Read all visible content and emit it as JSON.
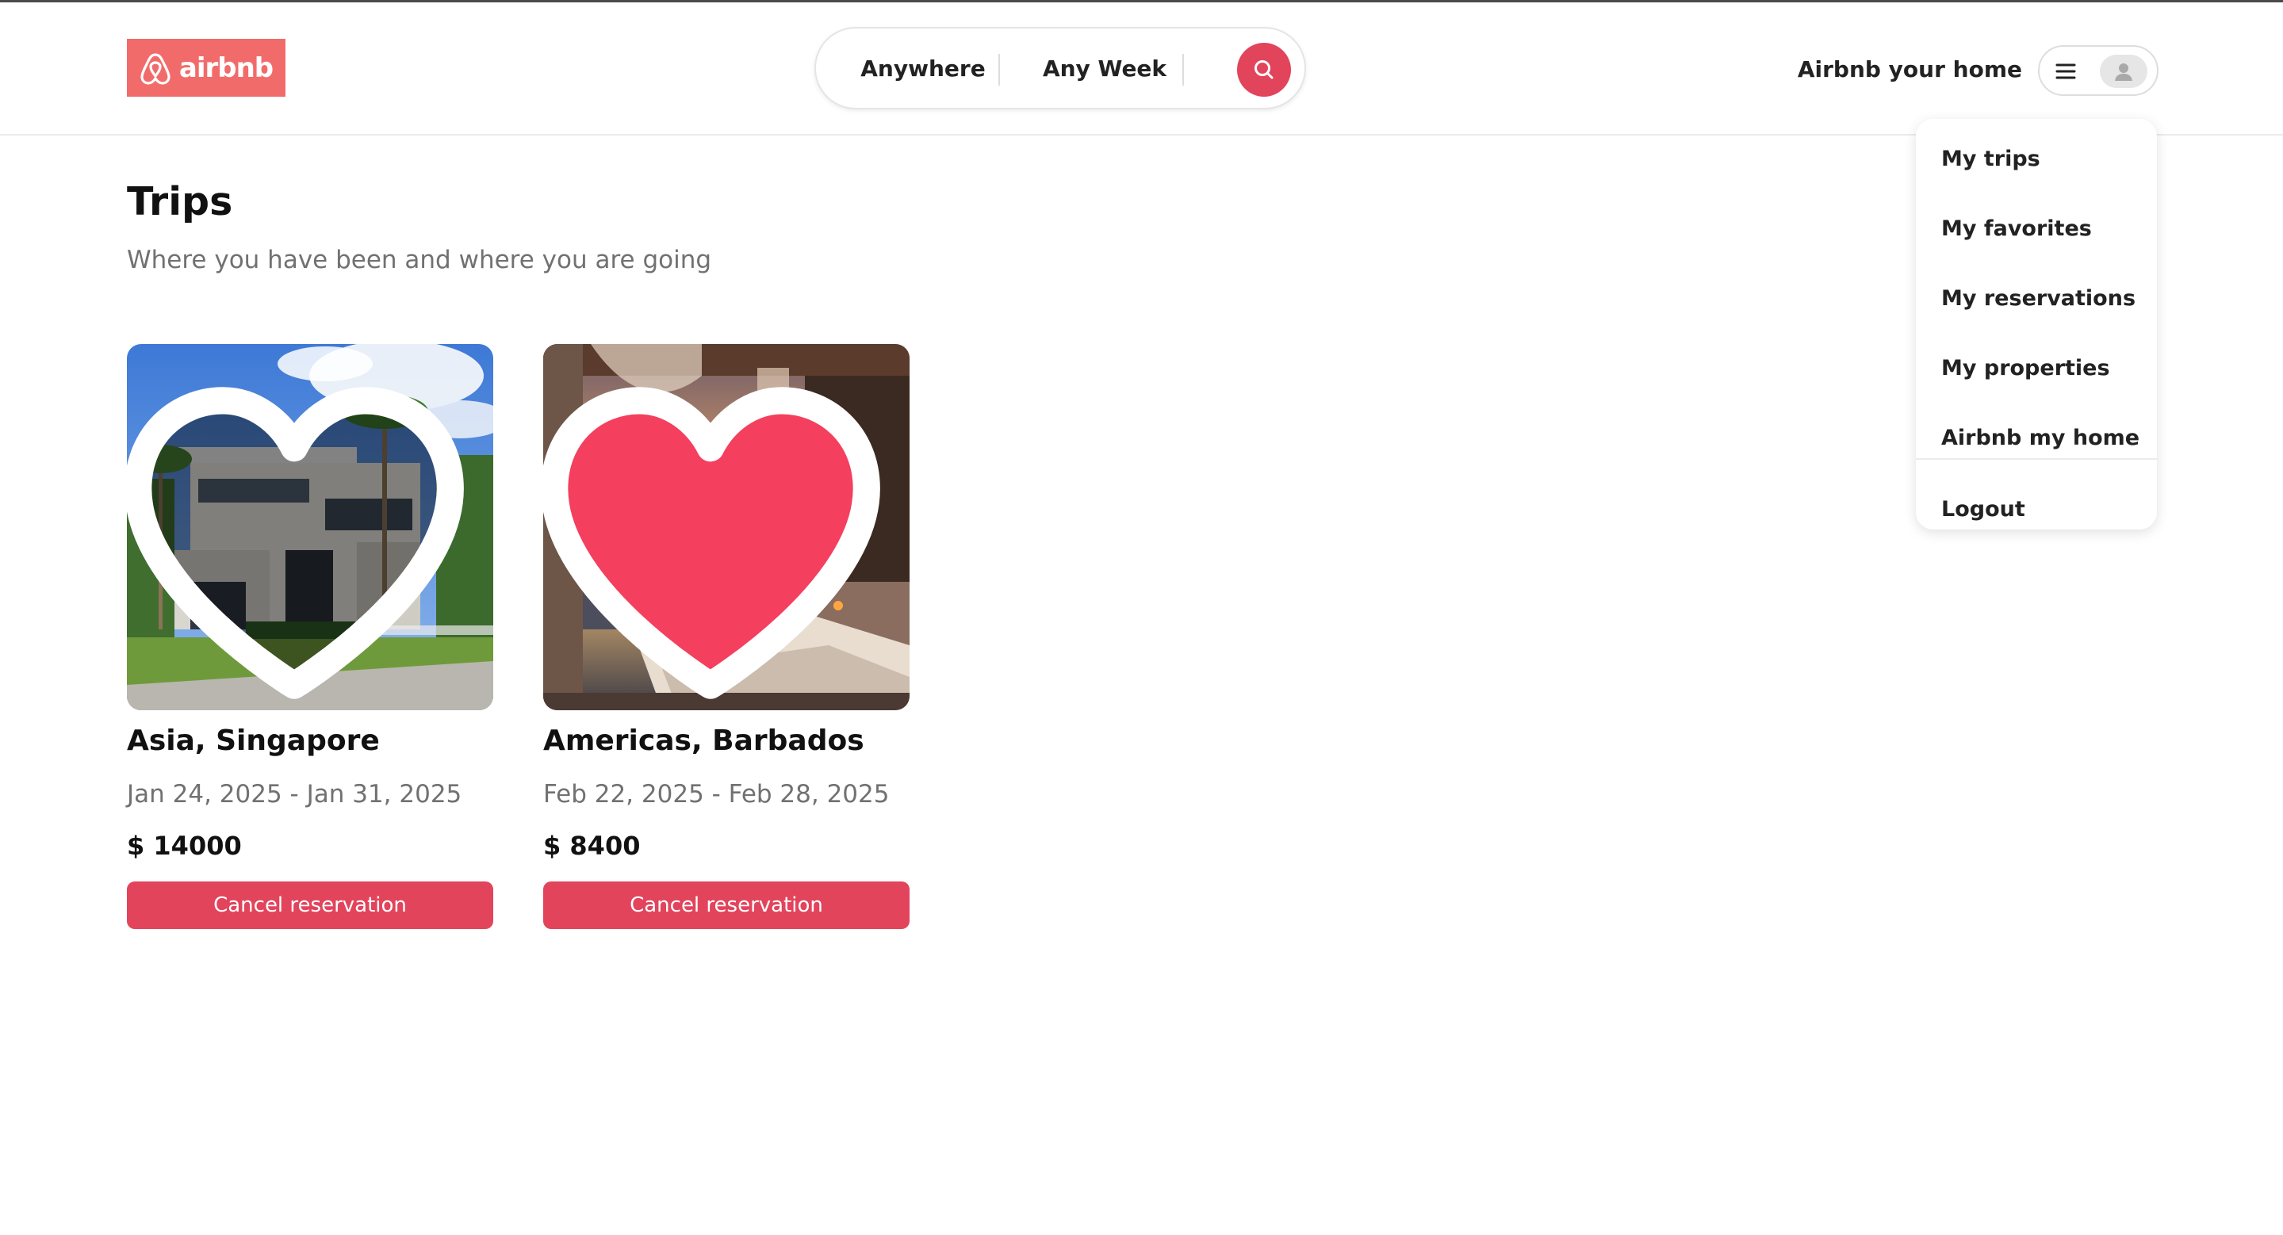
{
  "brand": {
    "name": "airbnb",
    "logo_color": "#F26B6B",
    "accent_color": "#E2445C"
  },
  "header": {
    "search": {
      "location_label": "Anywhere",
      "week_label": "Any Week",
      "button_icon": "search-icon"
    },
    "host_link": "Airbnb your home",
    "user_menu": {
      "menu_icon": "hamburger-menu-icon",
      "avatar_icon": "user-avatar-icon"
    }
  },
  "dropdown_menu": {
    "items": [
      {
        "label": "My trips"
      },
      {
        "label": "My favorites"
      },
      {
        "label": "My reservations"
      },
      {
        "label": "My properties"
      },
      {
        "label": "Airbnb my home"
      },
      {
        "label": "Logout"
      }
    ]
  },
  "page": {
    "title": "Trips",
    "subtitle": "Where you have been and where you are going"
  },
  "trips": [
    {
      "location": "Asia, Singapore",
      "dates": "Jan 24, 2025 - Jan 31, 2025",
      "price": "$ 14000",
      "favorited": false,
      "button_label": "Cancel reservation"
    },
    {
      "location": "Americas, Barbados",
      "dates": "Feb 22, 2025 - Feb 28, 2025",
      "price": "$ 8400",
      "favorited": true,
      "button_label": "Cancel reservation"
    }
  ]
}
